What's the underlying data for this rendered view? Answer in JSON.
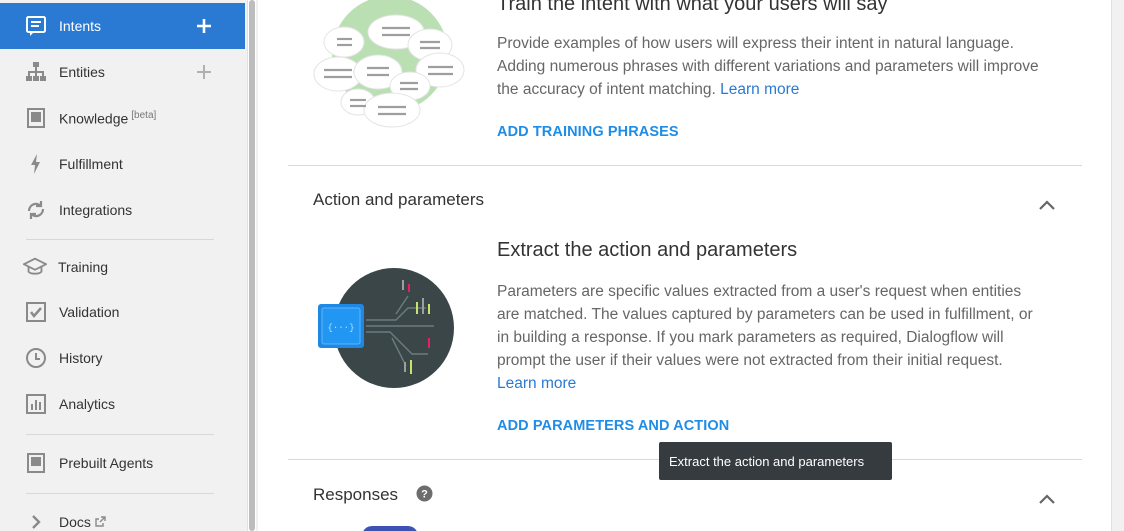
{
  "sidebar": {
    "items": [
      {
        "label": "Intents",
        "icon": "chat-icon"
      },
      {
        "label": "Entities",
        "icon": "sitemap-icon"
      },
      {
        "label": "Knowledge",
        "sup": "[beta]",
        "icon": "book-icon"
      },
      {
        "label": "Fulfillment",
        "icon": "bolt-icon"
      },
      {
        "label": "Integrations",
        "icon": "sync-icon"
      },
      {
        "label": "Training",
        "icon": "graduation-cap-icon"
      },
      {
        "label": "Validation",
        "icon": "checkbox-icon"
      },
      {
        "label": "History",
        "icon": "clock-icon"
      },
      {
        "label": "Analytics",
        "icon": "bar-chart-icon"
      },
      {
        "label": "Prebuilt Agents",
        "icon": "tablet-icon"
      },
      {
        "label": "Docs",
        "icon": "chevron-right-icon"
      }
    ]
  },
  "training": {
    "heading": "Train the intent with what your users will say",
    "description": "Provide examples of how users will express their intent in natural language. Adding numerous phrases with different variations and parameters will improve the accuracy of intent matching.",
    "learn_more": "Learn more",
    "cta": "ADD TRAINING PHRASES"
  },
  "action": {
    "section_title": "Action and parameters",
    "heading": "Extract the action and parameters",
    "description": "Parameters are specific values extracted from a user's request when entities are matched. The values captured by parameters can be used in fulfillment, or in building a response. If you mark parameters as required, Dialogflow will prompt the user if their values were not extracted from their initial request.",
    "learn_more": "Learn more",
    "cta": "ADD PARAMETERS AND ACTION",
    "tooltip": "Extract the action and parameters"
  },
  "responses": {
    "section_title": "Responses"
  },
  "colors": {
    "accent": "#2a7ad4",
    "link": "#1f8ce6",
    "tooltip_bg": "#363b40"
  }
}
